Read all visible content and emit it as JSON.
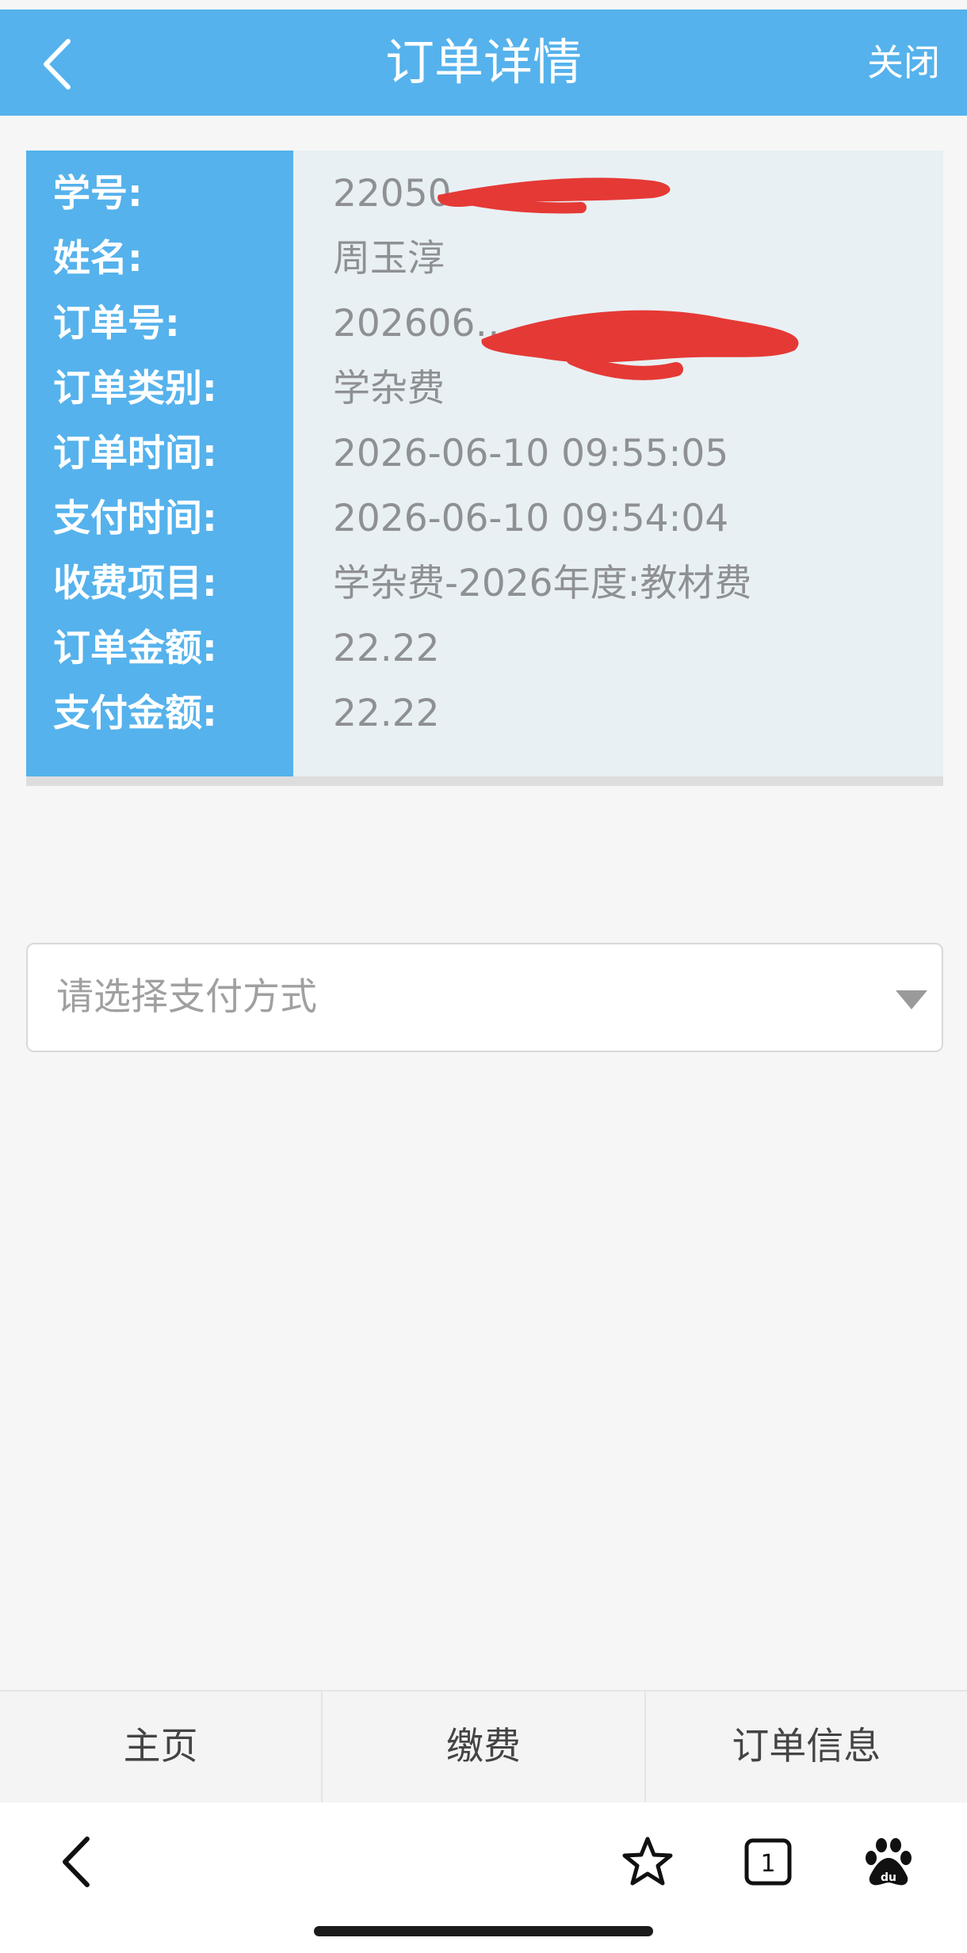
{
  "header": {
    "title": "订单详情",
    "close_label": "关闭",
    "background_color": "#55b2ec"
  },
  "order": {
    "rows": [
      {
        "label": "学号:",
        "value": "22050…"
      },
      {
        "label": "姓名:",
        "value": "周玉淳"
      },
      {
        "label": "订单号:",
        "value": "202606…"
      },
      {
        "label": "订单类别:",
        "value": "学杂费"
      },
      {
        "label": "订单时间:",
        "value": "2026-06-10 09:55:05"
      },
      {
        "label": "支付时间:",
        "value": "2026-06-10 09:54:04"
      },
      {
        "label": "收费项目:",
        "value": "学杂费-2026年度:教材费"
      },
      {
        "label": "订单金额:",
        "value": "22.22"
      },
      {
        "label": "支付金额:",
        "value": "22.22"
      }
    ]
  },
  "payment": {
    "placeholder": "请选择支付方式"
  },
  "tabbar": {
    "tabs": [
      {
        "label": "主页"
      },
      {
        "label": "缴费"
      },
      {
        "label": "订单信息"
      }
    ]
  },
  "browser": {
    "tab_count": "1",
    "icons": [
      "back-icon",
      "star-icon",
      "tabs-icon",
      "baidu-paw-icon"
    ]
  },
  "colors": {
    "accent": "#55b2ec",
    "redaction": "#e53935"
  }
}
